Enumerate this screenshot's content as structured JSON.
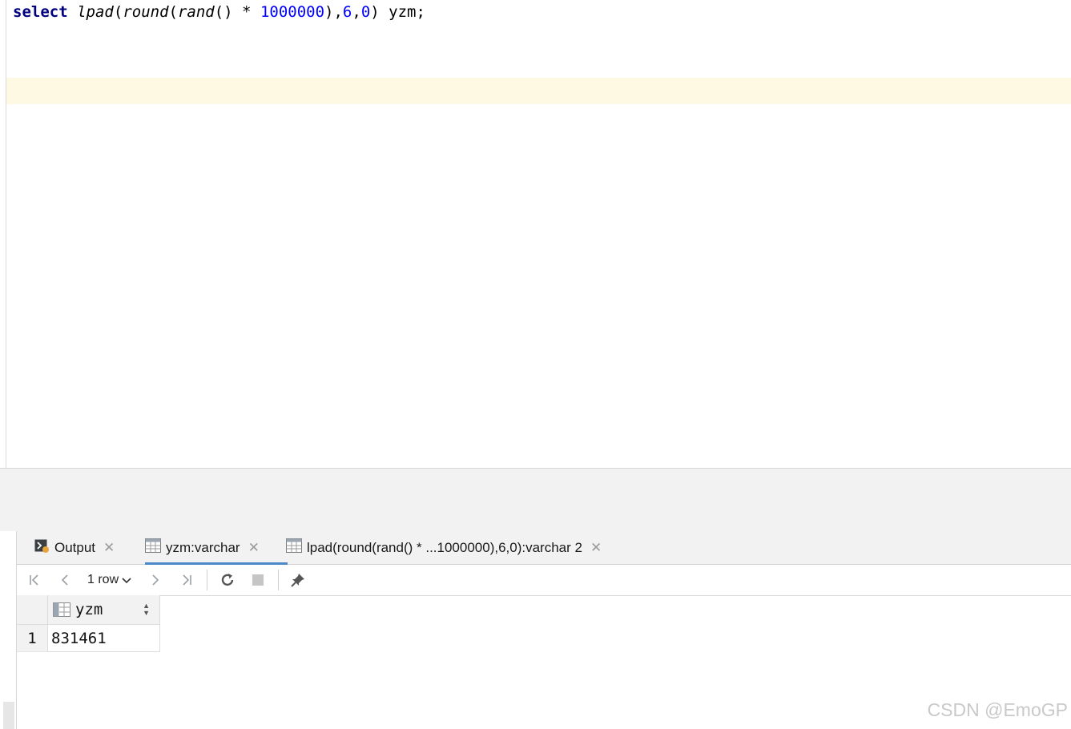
{
  "editor": {
    "tokens": {
      "select": "select",
      "lpad": "lpad",
      "p1": "(",
      "round": "round",
      "p2": "(",
      "rand": "rand",
      "p3": "() * ",
      "n1000000": "1000000",
      "p4": "),",
      "n6": "6",
      "comma": ",",
      "n0": "0",
      "p5": ") yzm;"
    }
  },
  "tabs": [
    {
      "label": "Output",
      "icon": "console-icon"
    },
    {
      "label": "yzm:varchar",
      "icon": "table-icon"
    },
    {
      "label": "lpad(round(rand() * ...1000000),6,0):varchar 2",
      "icon": "table-icon"
    }
  ],
  "toolbar": {
    "row_count": "1 row",
    "icons": [
      "first-page-icon",
      "prev-page-icon",
      "next-page-icon",
      "last-page-icon",
      "refresh-icon",
      "stop-icon",
      "pin-icon"
    ]
  },
  "grid": {
    "columns": [
      "yzm"
    ],
    "rows": [
      {
        "num": "1",
        "values": [
          "831461"
        ]
      }
    ]
  },
  "watermark": "CSDN @EmoGP"
}
